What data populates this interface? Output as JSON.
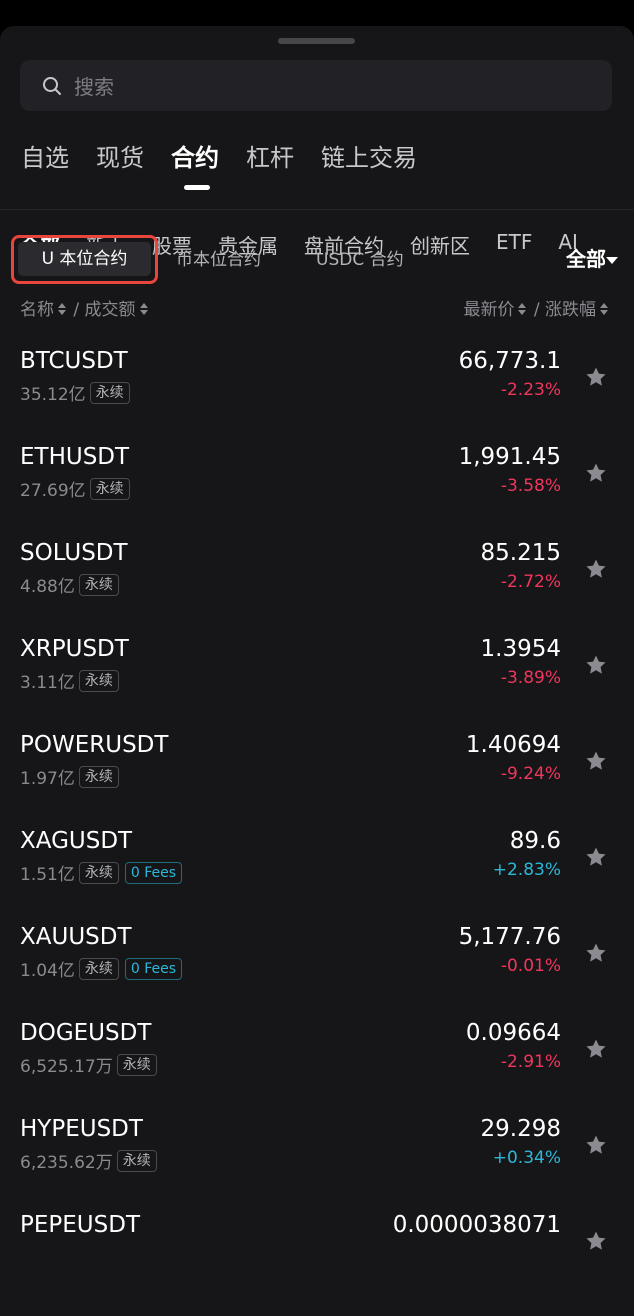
{
  "search": {
    "placeholder": "搜索"
  },
  "tabs1": [
    "自选",
    "现货",
    "合约",
    "杠杆",
    "链上交易"
  ],
  "tabs2": [
    "全部",
    "新上",
    "股票",
    "贵金属",
    "盘前合约",
    "创新区",
    "ETF",
    "AI"
  ],
  "segments": [
    "U 本位合约",
    "币本位合约",
    "USDC 合约"
  ],
  "filter_label": "全部",
  "header": {
    "name": "名称",
    "sep1": " / ",
    "volume": "成交额",
    "price": "最新价",
    "sep2": " / ",
    "change": "涨跌幅"
  },
  "rows": [
    {
      "symbol": "BTCUSDT",
      "volume": "35.12亿",
      "tag": "永续",
      "fees": "",
      "price": "66,773.1",
      "change": "-2.23%",
      "dir": "down"
    },
    {
      "symbol": "ETHUSDT",
      "volume": "27.69亿",
      "tag": "永续",
      "fees": "",
      "price": "1,991.45",
      "change": "-3.58%",
      "dir": "down"
    },
    {
      "symbol": "SOLUSDT",
      "volume": "4.88亿",
      "tag": "永续",
      "fees": "",
      "price": "85.215",
      "change": "-2.72%",
      "dir": "down"
    },
    {
      "symbol": "XRPUSDT",
      "volume": "3.11亿",
      "tag": "永续",
      "fees": "",
      "price": "1.3954",
      "change": "-3.89%",
      "dir": "down"
    },
    {
      "symbol": "POWERUSDT",
      "volume": "1.97亿",
      "tag": "永续",
      "fees": "",
      "price": "1.40694",
      "change": "-9.24%",
      "dir": "down"
    },
    {
      "symbol": "XAGUSDT",
      "volume": "1.51亿",
      "tag": "永续",
      "fees": "0 Fees",
      "price": "89.6",
      "change": "+2.83%",
      "dir": "up"
    },
    {
      "symbol": "XAUUSDT",
      "volume": "1.04亿",
      "tag": "永续",
      "fees": "0 Fees",
      "price": "5,177.76",
      "change": "-0.01%",
      "dir": "down"
    },
    {
      "symbol": "DOGEUSDT",
      "volume": "6,525.17万",
      "tag": "永续",
      "fees": "",
      "price": "0.09664",
      "change": "-2.91%",
      "dir": "down"
    },
    {
      "symbol": "HYPEUSDT",
      "volume": "6,235.62万",
      "tag": "永续",
      "fees": "",
      "price": "29.298",
      "change": "+0.34%",
      "dir": "up"
    },
    {
      "symbol": "PEPEUSDT",
      "volume": "",
      "tag": "",
      "fees": "",
      "price": "0.0000038071",
      "change": "",
      "dir": "down"
    }
  ]
}
